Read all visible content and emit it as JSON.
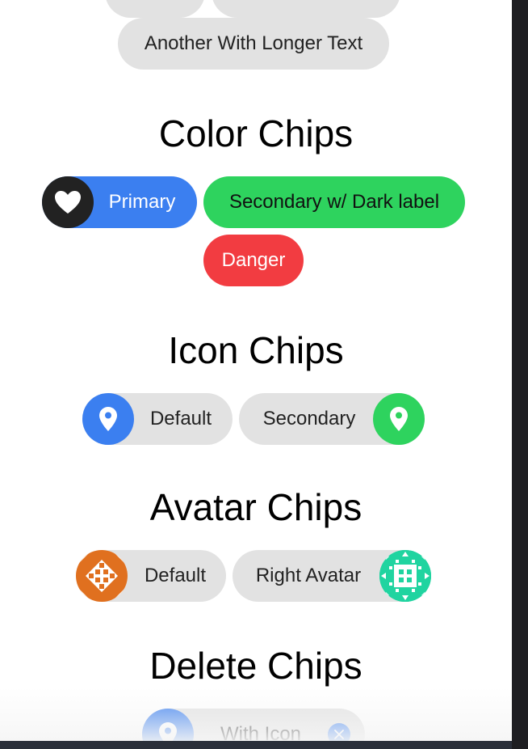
{
  "basic": {
    "long_chip": "Another With Longer Text"
  },
  "color_section": {
    "title": "Color Chips",
    "primary": "Primary",
    "secondary": "Secondary w/ Dark label",
    "danger": "Danger",
    "primary_icon": "heart-icon",
    "colors": {
      "primary": "#3b7ff0",
      "secondary": "#2ed35e",
      "danger": "#f23c41",
      "icon_bg": "#222222"
    }
  },
  "icon_section": {
    "title": "Icon Chips",
    "default": "Default",
    "secondary": "Secondary",
    "icon": "location-pin-icon"
  },
  "avatar_section": {
    "title": "Avatar Chips",
    "default": "Default",
    "right": "Right Avatar",
    "avatar_colors": {
      "left": "#e0701f",
      "right": "#20d4a0"
    }
  },
  "delete_section": {
    "title": "Delete Chips",
    "with_icon": "With Icon",
    "delete_icon": "close-icon"
  }
}
